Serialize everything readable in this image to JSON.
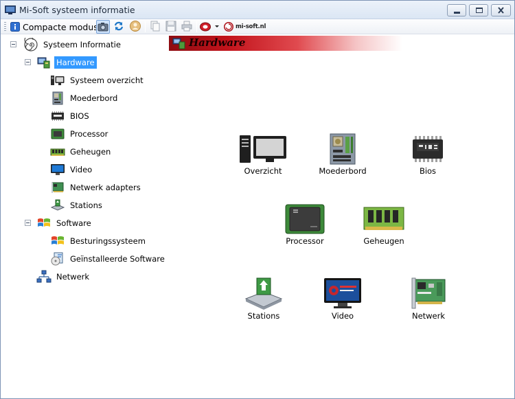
{
  "window": {
    "title": "Mi-Soft systeem informatie"
  },
  "toolbar": {
    "compact_label": "Compacte modus",
    "brand": "mi-soft.nl"
  },
  "tree": {
    "root": "Systeem Informatie",
    "hardware": "Hardware",
    "hardware_items": [
      "Systeem overzicht",
      "Moederbord",
      "BIOS",
      "Processor",
      "Geheugen",
      "Video",
      "Netwerk adapters",
      "Stations"
    ],
    "software": "Software",
    "software_items": [
      "Besturingssysteem",
      "Geïnstalleerde Software"
    ],
    "netwerk": "Netwerk"
  },
  "content": {
    "header": "Hardware",
    "tiles": [
      "Overzicht",
      "Moederbord",
      "Bios",
      "Processor",
      "Geheugen",
      "Stations",
      "Video",
      "Netwerk"
    ]
  },
  "colors": {
    "selection": "#3399ff",
    "banner": "#c2131b"
  }
}
